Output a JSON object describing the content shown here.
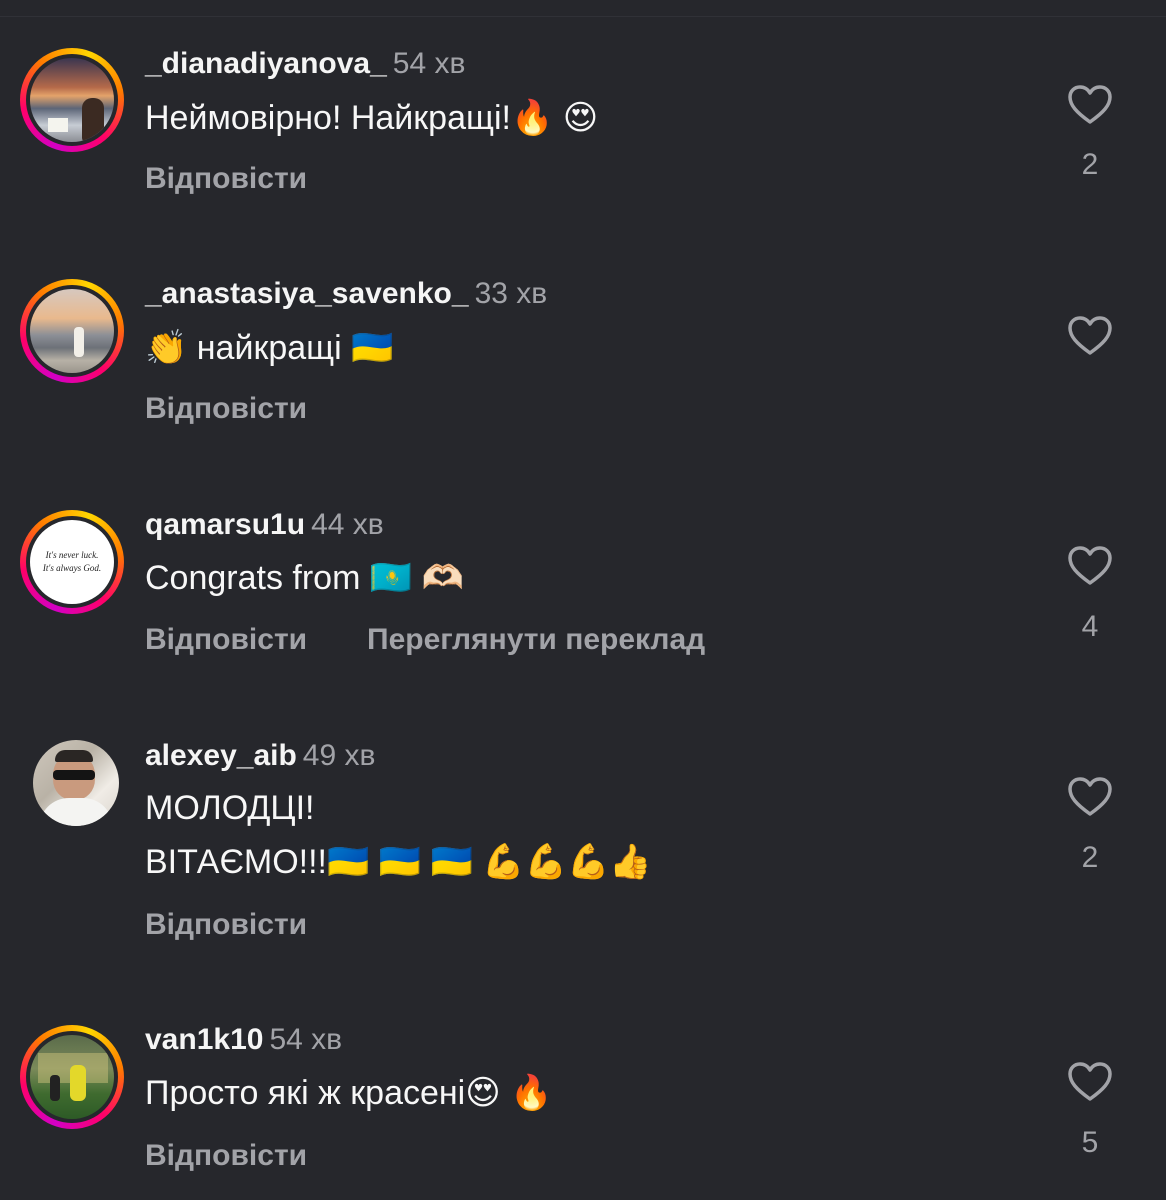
{
  "comments": [
    {
      "username": "_dianadiyanova_",
      "time": "54 хв",
      "text": "Неймовірно! Найкращі!🔥 😍",
      "reply_label": "Відповісти",
      "likes": "2",
      "has_story_ring": true
    },
    {
      "username": "_anastasiya_savenko_",
      "time": "33 хв",
      "text": "👏 найкращі 🇺🇦",
      "reply_label": "Відповісти",
      "likes": "",
      "has_story_ring": true
    },
    {
      "username": "qamarsu1u",
      "time": "44 хв",
      "text": "Congrats from 🇰🇿 🫶🏻",
      "reply_label": "Відповісти",
      "translate_label": "Переглянути переклад",
      "likes": "4",
      "has_story_ring": true,
      "avatar_text": [
        "It's never luck.",
        "It's always God."
      ]
    },
    {
      "username": "alexey_aib",
      "time": "49 хв",
      "text_line1": "МОЛОДЦІ!",
      "text_line2": "ВІТАЄМО!!!🇺🇦 🇺🇦 🇺🇦 💪💪💪👍",
      "reply_label": "Відповісти",
      "likes": "2",
      "has_story_ring": false
    },
    {
      "username": "van1k10",
      "time": "54 хв",
      "text": "Просто які ж красені😍 🔥",
      "reply_label": "Відповісти",
      "likes": "5",
      "has_story_ring": true
    }
  ],
  "colors": {
    "background": "#26272c",
    "secondary_text": "#a2a3a8",
    "primary_text": "#f5f5f5"
  }
}
